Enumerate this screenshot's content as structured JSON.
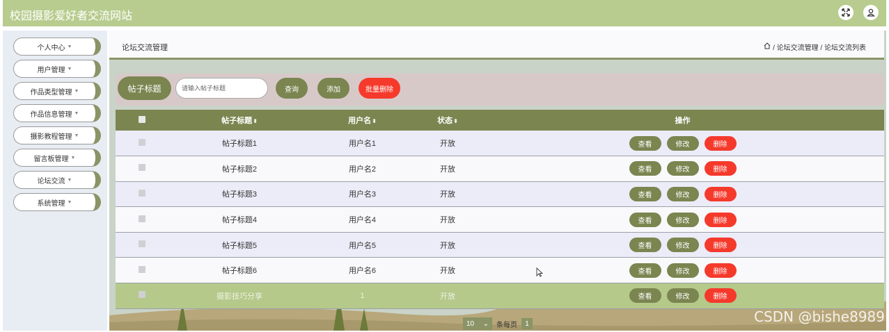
{
  "app": {
    "title": "校园摄影爱好者交流网站",
    "icons": [
      "fullscreen-icon",
      "user-icon"
    ]
  },
  "sidebar": {
    "items": [
      {
        "label": "个人中心"
      },
      {
        "label": "用户管理"
      },
      {
        "label": "作品类型管理"
      },
      {
        "label": "作品信息管理"
      },
      {
        "label": "摄影教程管理"
      },
      {
        "label": "留言板管理"
      },
      {
        "label": "论坛交流"
      },
      {
        "label": "系统管理"
      }
    ]
  },
  "header": {
    "page_title": "论坛交流管理",
    "breadcrumb": "/ 论坛交流管理 / 论坛交流列表"
  },
  "search": {
    "label": "帖子标题",
    "placeholder": "请输入帖子标题",
    "query_button": "查询",
    "add_button": "添加",
    "batch_delete_button": "批量删除"
  },
  "table": {
    "columns": [
      "帖子标题",
      "用户名",
      "状态",
      "操作"
    ],
    "actions": {
      "view": "查看",
      "edit": "修改",
      "delete": "删除"
    },
    "rows": [
      {
        "title": "帖子标题1",
        "user": "用户名1",
        "status": "开放"
      },
      {
        "title": "帖子标题2",
        "user": "用户名2",
        "status": "开放"
      },
      {
        "title": "帖子标题3",
        "user": "用户名3",
        "status": "开放"
      },
      {
        "title": "帖子标题4",
        "user": "用户名4",
        "status": "开放"
      },
      {
        "title": "帖子标题5",
        "user": "用户名5",
        "status": "开放"
      },
      {
        "title": "帖子标题6",
        "user": "用户名6",
        "status": "开放"
      },
      {
        "title": "摄影技巧分享",
        "user": "1",
        "status": "开放"
      }
    ],
    "highlighted_row": 6
  },
  "pager": {
    "page_size": "10",
    "per_page_label": "条每页",
    "current_page": "1"
  },
  "watermark": "CSDN @bishe8989",
  "colors": {
    "topbar": "#b7cc8e",
    "olive": "#7a8550",
    "danger": "#f53a2c",
    "highlight_row": "#b5c98b"
  }
}
